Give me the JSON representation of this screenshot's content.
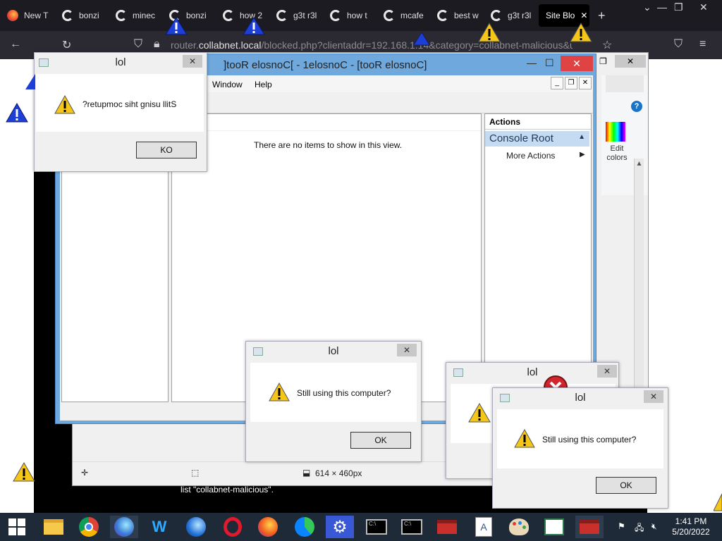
{
  "browser": {
    "tabs": [
      {
        "label": "New T",
        "icon": "firefox-icon"
      },
      {
        "label": "bonzi",
        "icon": "google-icon"
      },
      {
        "label": "minec",
        "icon": "google-icon"
      },
      {
        "label": "bonzi",
        "icon": "google-icon"
      },
      {
        "label": "how 2",
        "icon": "google-icon"
      },
      {
        "label": "g3t r3l",
        "icon": "google-icon"
      },
      {
        "label": "how t",
        "icon": "google-icon"
      },
      {
        "label": "mcafe",
        "icon": "google-icon"
      },
      {
        "label": "best w",
        "icon": "google-icon"
      },
      {
        "label": "g3t r3l",
        "icon": "google-icon"
      },
      {
        "label": "Site Blo",
        "icon": "none"
      }
    ],
    "url_prefix": "router.",
    "url_host": "collabnet.local",
    "url_rest": "/blocked.php?clientaddr=192.168.1.14&category=collabnet-malicious&u"
  },
  "page": {
    "blocked_text": "list \"collabnet-malicious\"."
  },
  "mmc": {
    "title": "]tooR elosnoC[ - 1elosnoC - [tooR elosnoC]",
    "menu": [
      "Window",
      "Help"
    ],
    "empty_text": "There are no items to show in this view.",
    "actions_header": "Actions",
    "actions_root": "Console Root",
    "more_actions": "More Actions"
  },
  "paint": {
    "edit_colors": "Edit colors",
    "size_label": "614 × 460px"
  },
  "dialogs": [
    {
      "title": "lol",
      "message": "?retupmoc siht gnisu llitS",
      "button": "KO"
    },
    {
      "title": "lol",
      "message": "Still using this computer?",
      "button": "OK"
    },
    {
      "title": "lol",
      "message": "",
      "button": ""
    },
    {
      "title": "lol",
      "message": "Still using this computer?",
      "button": "OK"
    }
  ],
  "taskbar": {
    "time": "1:41 PM",
    "date": "5/20/2022"
  },
  "colors": {
    "tabbar": "#1c1b22",
    "navbar": "#2b2a33",
    "mmc_frame": "#6fa8dc",
    "close_red": "#e04343",
    "taskbar": "#1e2a38",
    "warning_yellow": "#f5c518"
  }
}
